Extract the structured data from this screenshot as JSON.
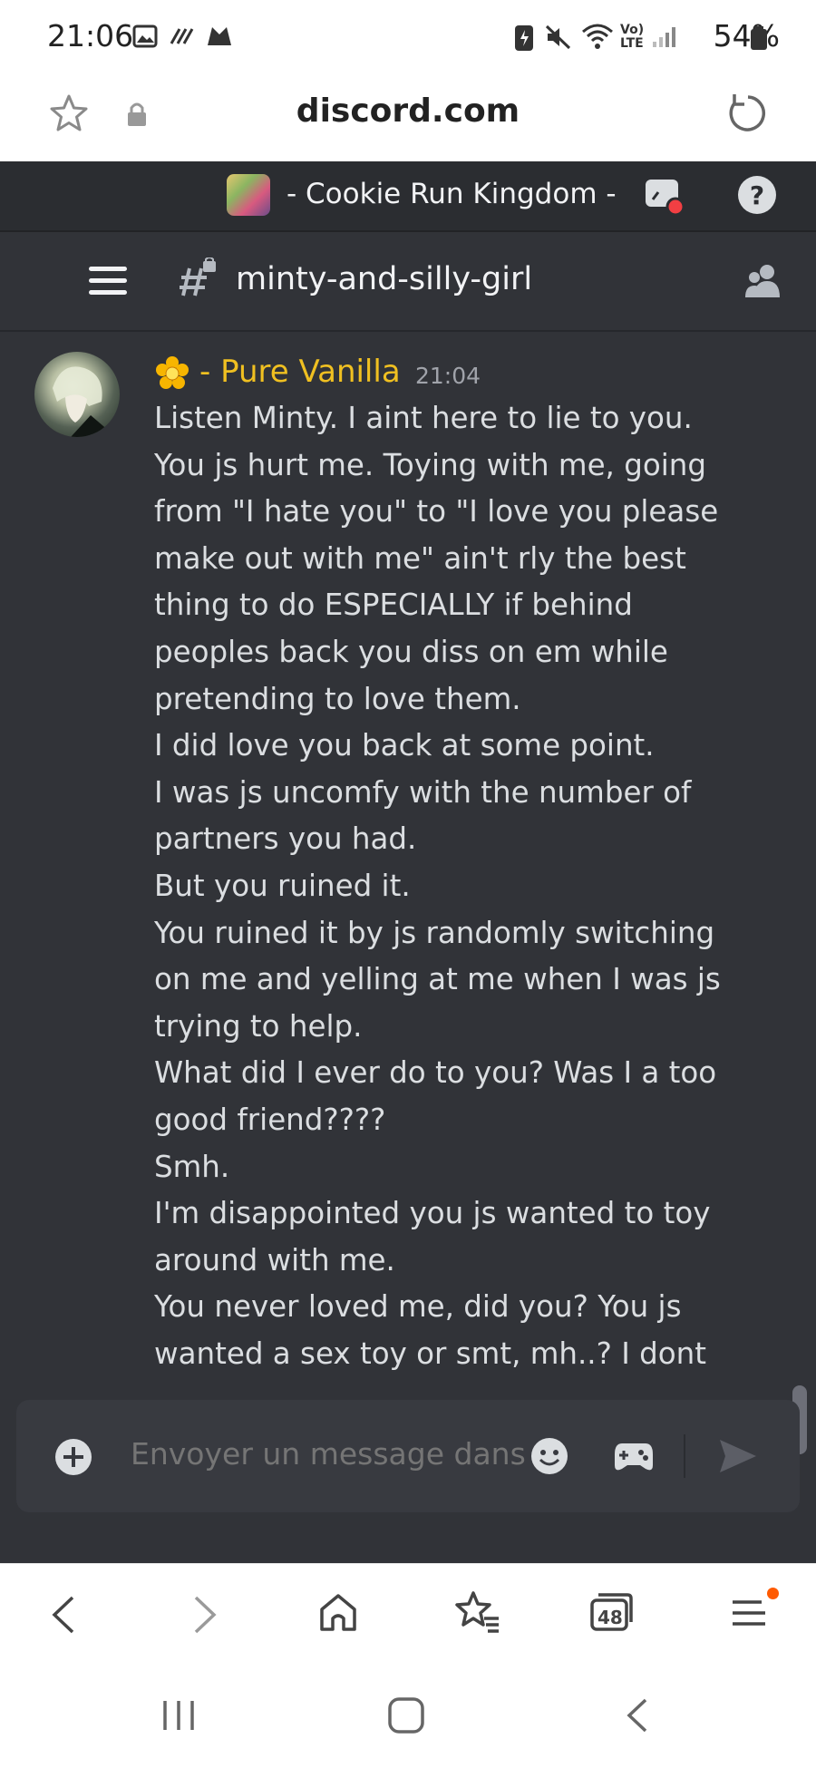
{
  "status_bar": {
    "time": "21:06",
    "battery": "54%",
    "network": "LTE"
  },
  "browser": {
    "domain": "discord.com",
    "tab_count": "48",
    "icons": [
      "star-icon",
      "lock-icon",
      "reload-icon",
      "back-icon",
      "forward-icon",
      "home-icon",
      "bookmarks-icon",
      "tabs-icon",
      "menu-icon"
    ]
  },
  "server": {
    "name": "- Cookie Run Kingdom -"
  },
  "channel": {
    "name": "minty-and-silly-girl"
  },
  "message": {
    "author": "- Pure Vanilla",
    "author_color": "#f0c021",
    "timestamp": "21:04",
    "lines": [
      "Listen Minty. I aint here to lie to you.",
      "You js hurt me. Toying with me, going",
      "from \"I hate you\" to \"I love you please",
      "make out with me\" ain't rly the best",
      "thing to do ESPECIALLY if behind",
      "peoples back you diss on em while",
      "pretending to love them.",
      "I did love you back at some point.",
      "I was js uncomfy with the number of",
      "partners you had.",
      "But you ruined it.",
      "You ruined it by js randomly switching",
      "on me and yelling at me when I was js",
      "trying to help.",
      "What did I ever do to you? Was I a too",
      "good friend????",
      "Smh.",
      "I'm disappointed you js wanted to toy",
      "around with me.",
      "You never loved me, did you? You js",
      "wanted a sex toy or smt, mh..? I dont"
    ]
  },
  "composer": {
    "placeholder": "Envoyer un message dans #"
  },
  "colors": {
    "discord_bg": "#313338",
    "header_bg": "#2b2d31",
    "composer_bg": "#383a40",
    "text": "#dbdee1"
  }
}
